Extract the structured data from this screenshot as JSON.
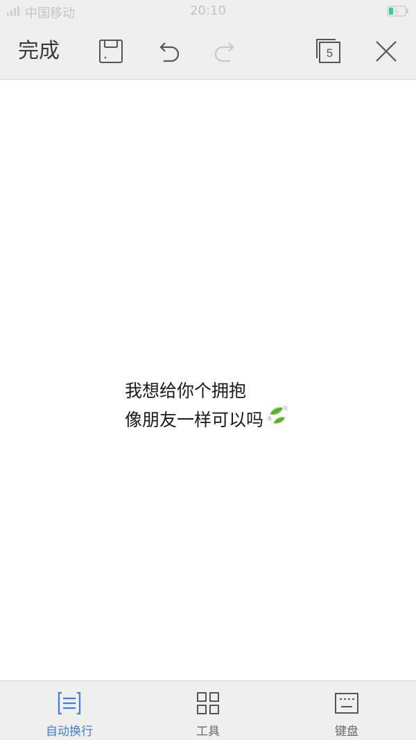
{
  "status_bar": {
    "carrier": "中国移动",
    "time": "20:10",
    "signal_icon": "signal-icon",
    "battery_icon": "battery-icon"
  },
  "top_toolbar": {
    "done_label": "完成",
    "save_icon": "save-icon",
    "undo_icon": "undo-icon",
    "redo_icon": "redo-icon",
    "pages_count": "5",
    "close_icon": "close-icon"
  },
  "editor": {
    "lines": [
      "我想给你个拥抱",
      "像朋友一样可以吗"
    ],
    "emoji": "leaf-fluttering-emoji"
  },
  "bottom_toolbar": {
    "items": [
      {
        "label": "自动换行",
        "icon": "word-wrap-icon",
        "active": true
      },
      {
        "label": "工具",
        "icon": "grid-tools-icon",
        "active": false
      },
      {
        "label": "键盘",
        "icon": "keyboard-icon",
        "active": false
      }
    ]
  },
  "colors": {
    "accent": "#3f7fd6",
    "toolbar_bg": "#efefef",
    "icon_gray": "#555555",
    "disabled_gray": "#c8c8c8"
  }
}
